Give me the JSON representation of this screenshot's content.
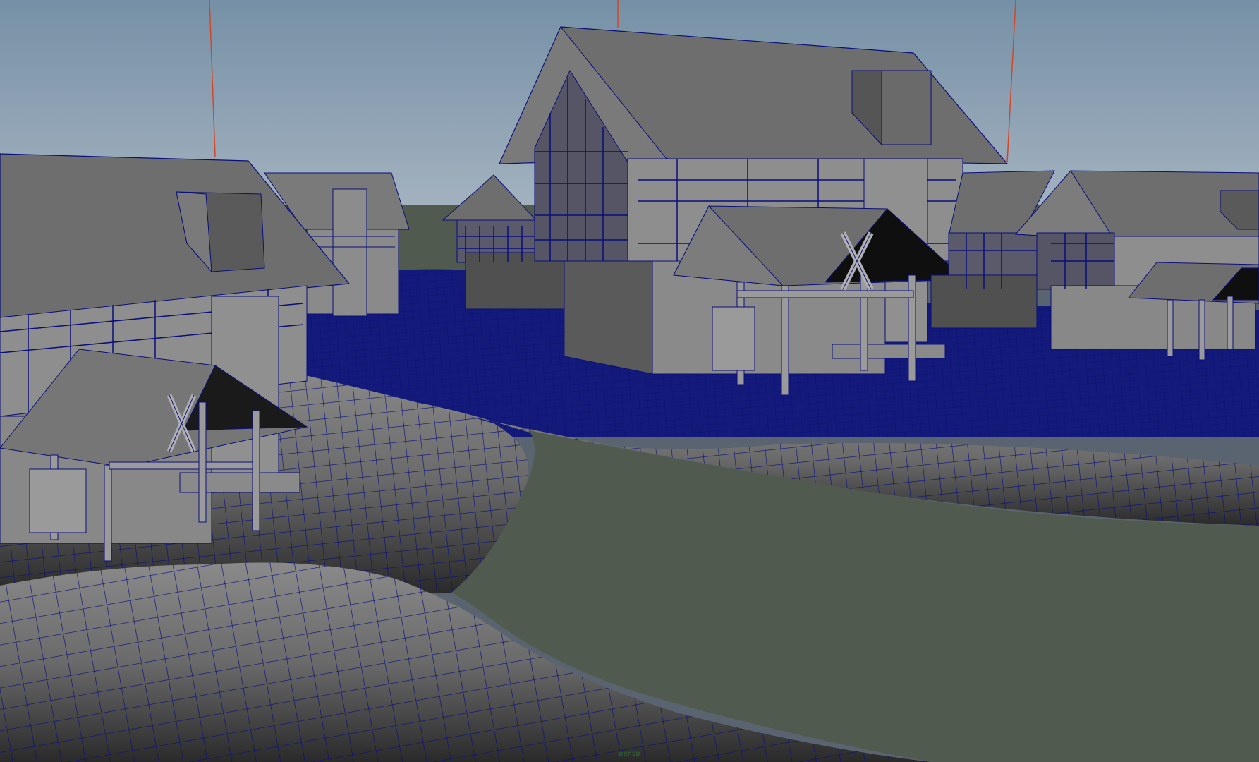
{
  "viewport": {
    "camera_label": "persp"
  },
  "colors": {
    "sky_top": "#7590a6",
    "sky_bottom": "#a9b6c2",
    "wire": "#0a0f7a",
    "ground_plane": "#505a4e",
    "building_face": "#8a8a8a",
    "building_roof": "#6e6e6e",
    "building_shadow": "#4a4a4a",
    "gizmo_line": "#d2462a"
  }
}
